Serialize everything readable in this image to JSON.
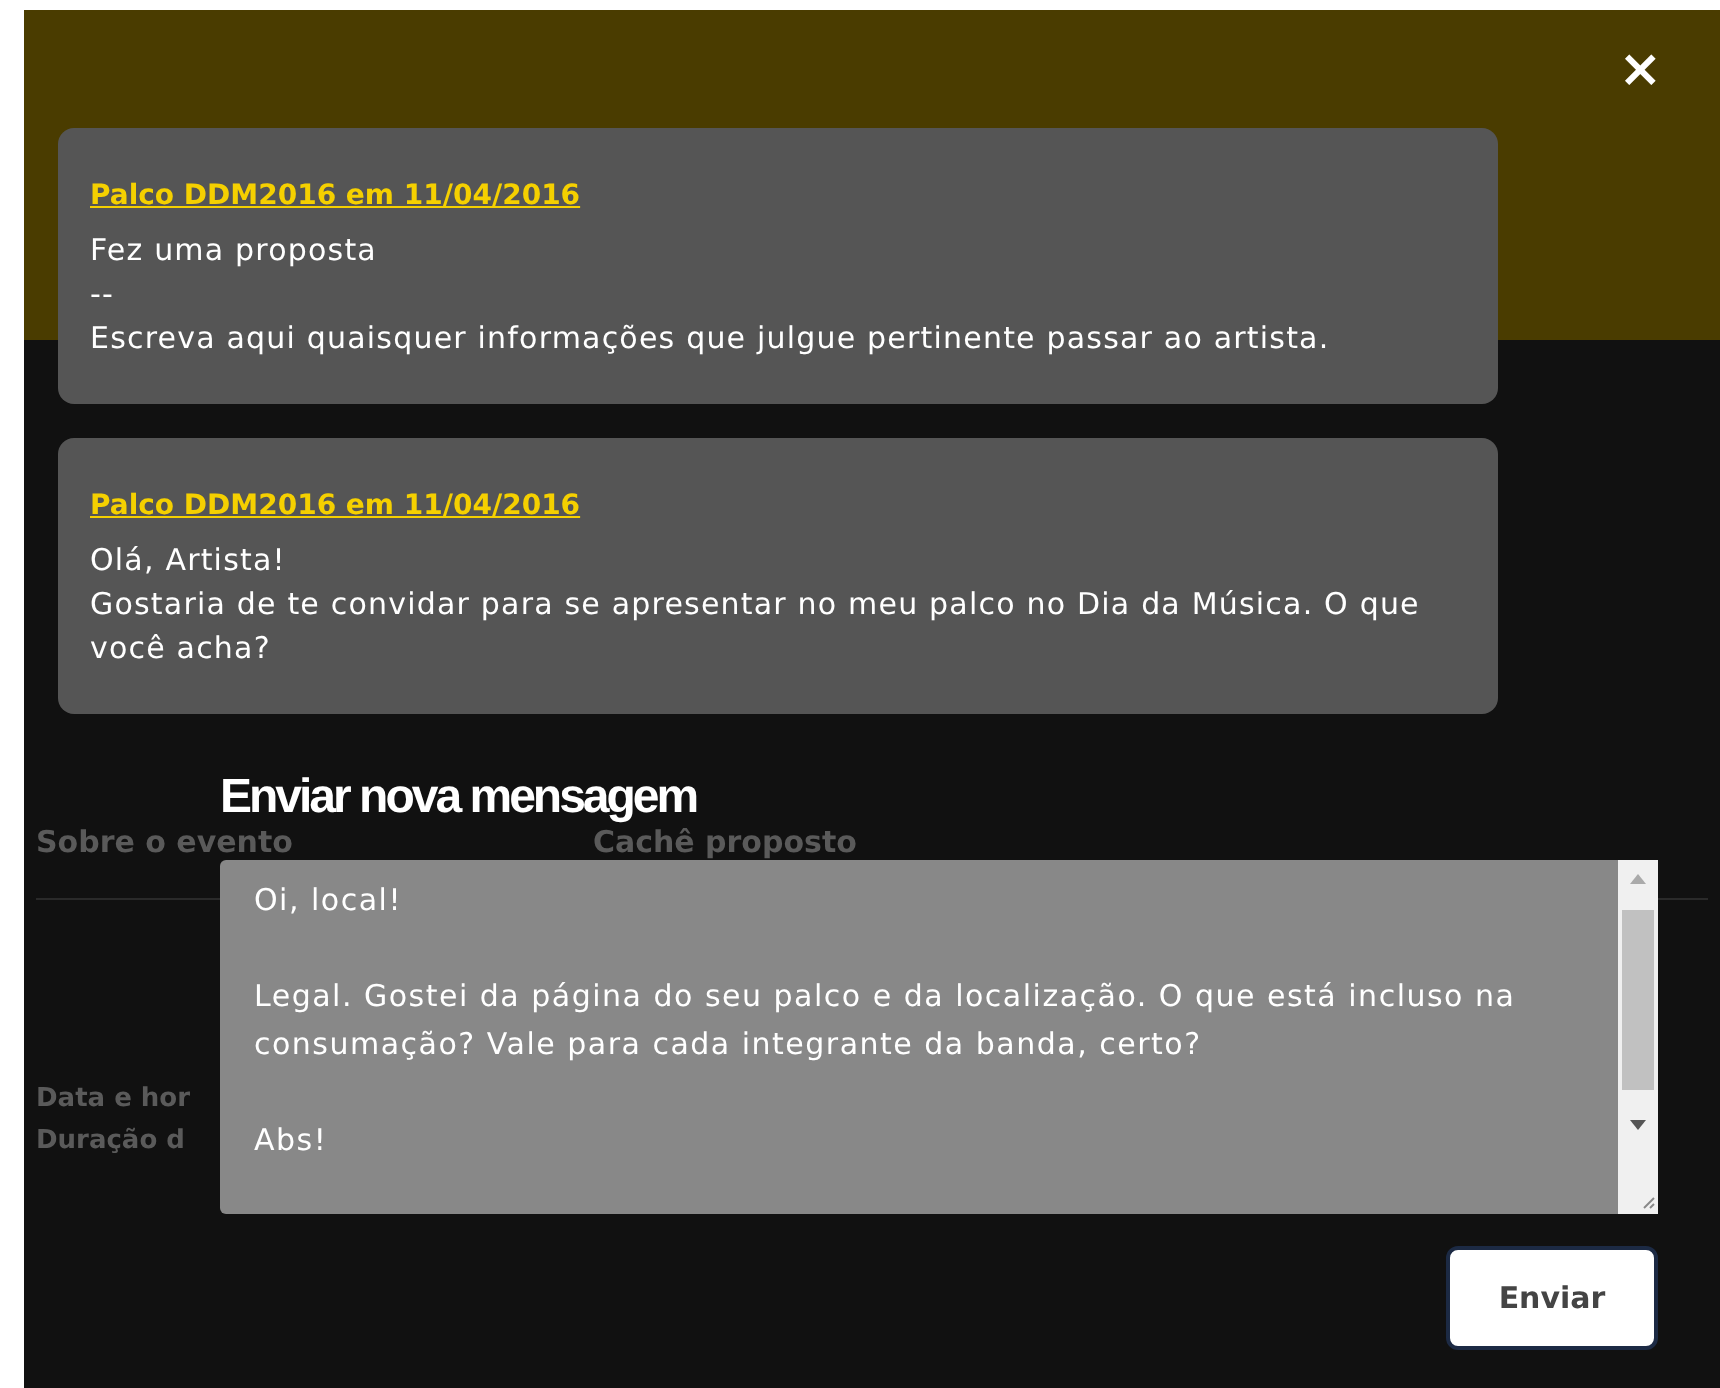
{
  "background": {
    "headings": [
      "Sobre o evento",
      "Cachê proposto"
    ],
    "details": [
      "Data e hor",
      "Duração d"
    ]
  },
  "modal": {
    "close": "×",
    "messages": [
      {
        "author": "Palco DDM2016 em 11/04/2016",
        "lines": [
          "Fez uma proposta",
          "--",
          "Escreva aqui quaisquer informações que julgue pertinente passar ao artista."
        ]
      },
      {
        "author": "Palco DDM2016 em 11/04/2016",
        "lines": [
          "Olá, Artista!",
          "Gostaria de te convidar para se apresentar no meu palco no Dia da Música. O que você acha?"
        ]
      }
    ],
    "compose": {
      "title": "Enviar nova mensagem",
      "value": "Oi, local!\n\nLegal. Gostei da página do seu palco e da localização. O que está incluso na consumação? Vale para cada integrante da banda, certo?\n\nAbs!",
      "button": "Enviar"
    }
  }
}
